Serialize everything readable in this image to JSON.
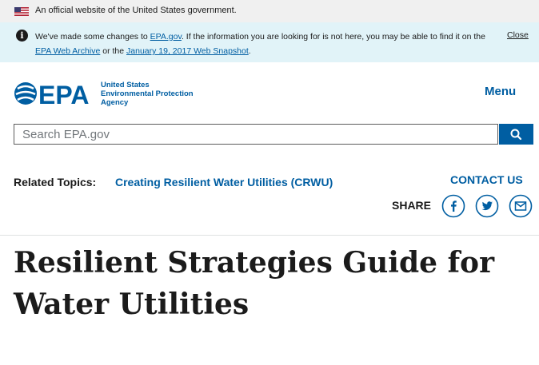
{
  "gov_banner": {
    "text": "An official website of the United States government."
  },
  "notice": {
    "part1": "We've made some changes to ",
    "link1": "EPA.gov",
    "part2": ". If the information you are looking for is not here, you may be able to find it on the ",
    "link2": "EPA Web Archive",
    "part3": " or the ",
    "link3": "January 19, 2017 Web Snapshot",
    "part4": ".",
    "close_label": "Close"
  },
  "header": {
    "logo_lines": [
      "United States",
      "Environmental Protection",
      "Agency"
    ],
    "menu_label": "Menu"
  },
  "search": {
    "placeholder": "Search EPA.gov"
  },
  "topics": {
    "label": "Related Topics:",
    "link": "Creating Resilient Water Utilities (CRWU)",
    "contact": "CONTACT US",
    "share_label": "SHARE"
  },
  "page": {
    "title": "Resilient Strategies Guide for Water Utilities"
  },
  "colors": {
    "brand": "#005ea2",
    "banner_bg": "#f0f0f0",
    "notice_bg": "#e1f3f8"
  },
  "icons": [
    "us-flag-icon",
    "info-icon",
    "epa-logo-icon",
    "search-icon",
    "facebook-icon",
    "twitter-icon",
    "email-icon"
  ]
}
